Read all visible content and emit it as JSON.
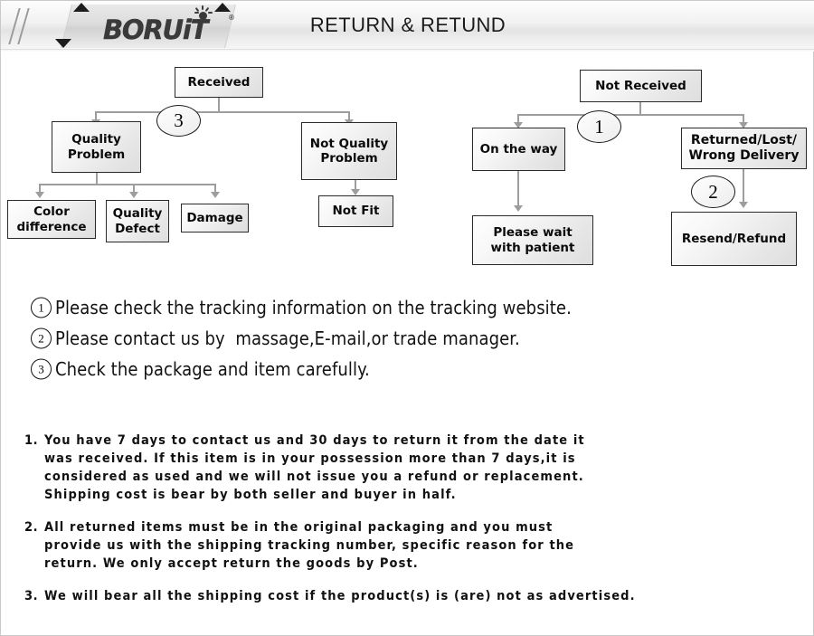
{
  "header": {
    "title": "RETURN & RETUND",
    "logo_text": "BORUiT",
    "logo_registered": "®",
    "bulb_icon": "lightbulb-icon"
  },
  "flowchart": {
    "left_tree": {
      "root": "Received",
      "badge": "3",
      "branch_left": "Quality\nProblem",
      "branch_right": "Not Quality\nProblem",
      "leaves": [
        "Color\ndifference",
        "Quality\nDefect",
        "Damage"
      ],
      "right_leaf": "Not Fit"
    },
    "right_tree": {
      "root": "Not  Received",
      "badge_top": "1",
      "badge_bottom": "2",
      "branch_left": "On the way",
      "branch_right": "Returned/Lost/\nWrong Delivery",
      "leaf_left": "Please wait\nwith patient",
      "leaf_right": "Resend/Refund"
    }
  },
  "notes": [
    {
      "num": "1",
      "text": "Please check the tracking information on the tracking website."
    },
    {
      "num": "2",
      "text": "Please contact us by  massage,E-mail,or trade manager."
    },
    {
      "num": "3",
      "text": "Check the package and item carefully."
    }
  ],
  "policy": [
    {
      "marker": "1.",
      "text": "You have 7 days to contact us and 30 days to return it from the date it\nwas received. If this item is in your possession more than 7 days,it is\nconsidered as used and we will not issue you a refund or replacement.\nShipping cost is bear by both seller and buyer in half."
    },
    {
      "marker": "2.",
      "text": "All returned items must be in the original packaging and you must\nprovide us with the shipping tracking number, specific reason for the\nreturn. We only accept return the goods by Post."
    },
    {
      "marker": "3.",
      "text": "We will bear all the shipping cost if the product(s) is (are) not as advertised."
    }
  ],
  "colors": {
    "header_bg": "#eeeeee",
    "node_border": "#2a2a2a",
    "connector": "#9d9d9d",
    "text": "#111111"
  }
}
